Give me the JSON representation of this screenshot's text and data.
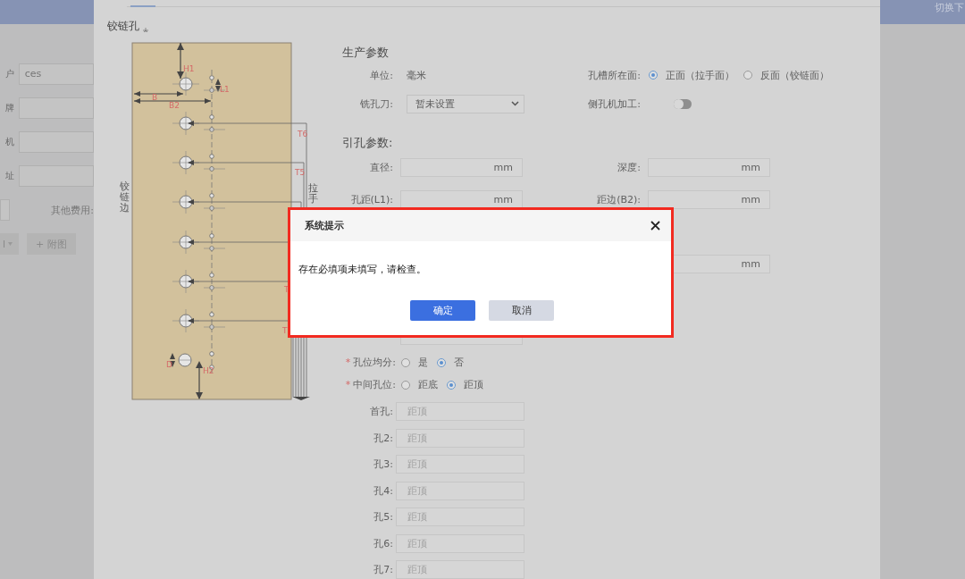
{
  "background_page": {
    "header_text": "切换下",
    "fields": [
      {
        "label": "户",
        "value": "ces"
      },
      {
        "label": "牌"
      },
      {
        "label": "机"
      },
      {
        "label": "址"
      }
    ],
    "other_fee_label": "其他费用:",
    "dropdown_text": "l",
    "attach_button": "+ 附图"
  },
  "panel": {
    "section_title": "铰链孔",
    "diagram_labels": [
      "H1",
      "L1",
      "B",
      "B2",
      "T6",
      "T5",
      "T",
      "T",
      "D",
      "H2"
    ],
    "hinge_edge": "铰链边",
    "handle_edge": "拉手"
  },
  "production": {
    "title": "生产参数",
    "unit": {
      "label": "单位:",
      "value": "毫米"
    },
    "face": {
      "label": "孔槽所在面:",
      "options": [
        {
          "label": "正面（拉手面）",
          "selected": true
        },
        {
          "label": "反面（铰链面）",
          "selected": false
        }
      ]
    },
    "cutter": {
      "label": "铣孔刀:",
      "value": "暂未设置"
    },
    "side_machining": {
      "label": "侧孔机加工:",
      "on": false
    }
  },
  "pilot": {
    "title": "引孔参数:",
    "rows": [
      {
        "left": {
          "label": "直径:",
          "unit": "mm"
        },
        "right": {
          "label": "深度:",
          "unit": "mm"
        }
      },
      {
        "left": {
          "label": "孔距(L1):",
          "unit": "mm"
        },
        "right": {
          "label": "距边(B2):",
          "unit": "mm"
        }
      },
      {
        "right": {
          "unit": "mm"
        }
      },
      {
        "left": {}
      }
    ]
  },
  "even_split": {
    "required_mark": "*",
    "label": "孔位均分:",
    "options": [
      {
        "label": "是",
        "selected": false
      },
      {
        "label": "否",
        "selected": true
      }
    ]
  },
  "middle_position": {
    "required_mark": "*",
    "label": "中间孔位:",
    "options": [
      {
        "label": "距底",
        "selected": false
      },
      {
        "label": "距顶",
        "selected": true
      }
    ]
  },
  "holes": [
    {
      "label": "首孔:",
      "placeholder": "距顶"
    },
    {
      "label": "孔2:",
      "placeholder": "距顶"
    },
    {
      "label": "孔3:",
      "placeholder": "距顶"
    },
    {
      "label": "孔4:",
      "placeholder": "距顶"
    },
    {
      "label": "孔5:",
      "placeholder": "距顶"
    },
    {
      "label": "孔6:",
      "placeholder": "距顶"
    },
    {
      "label": "孔7:",
      "placeholder": "距顶"
    }
  ],
  "dialog": {
    "title": "系统提示",
    "message": "存在必填项未填写，请检查。",
    "buttons": [
      {
        "label": "确定",
        "kind": "primary"
      },
      {
        "label": "取消",
        "kind": "secondary"
      }
    ]
  }
}
